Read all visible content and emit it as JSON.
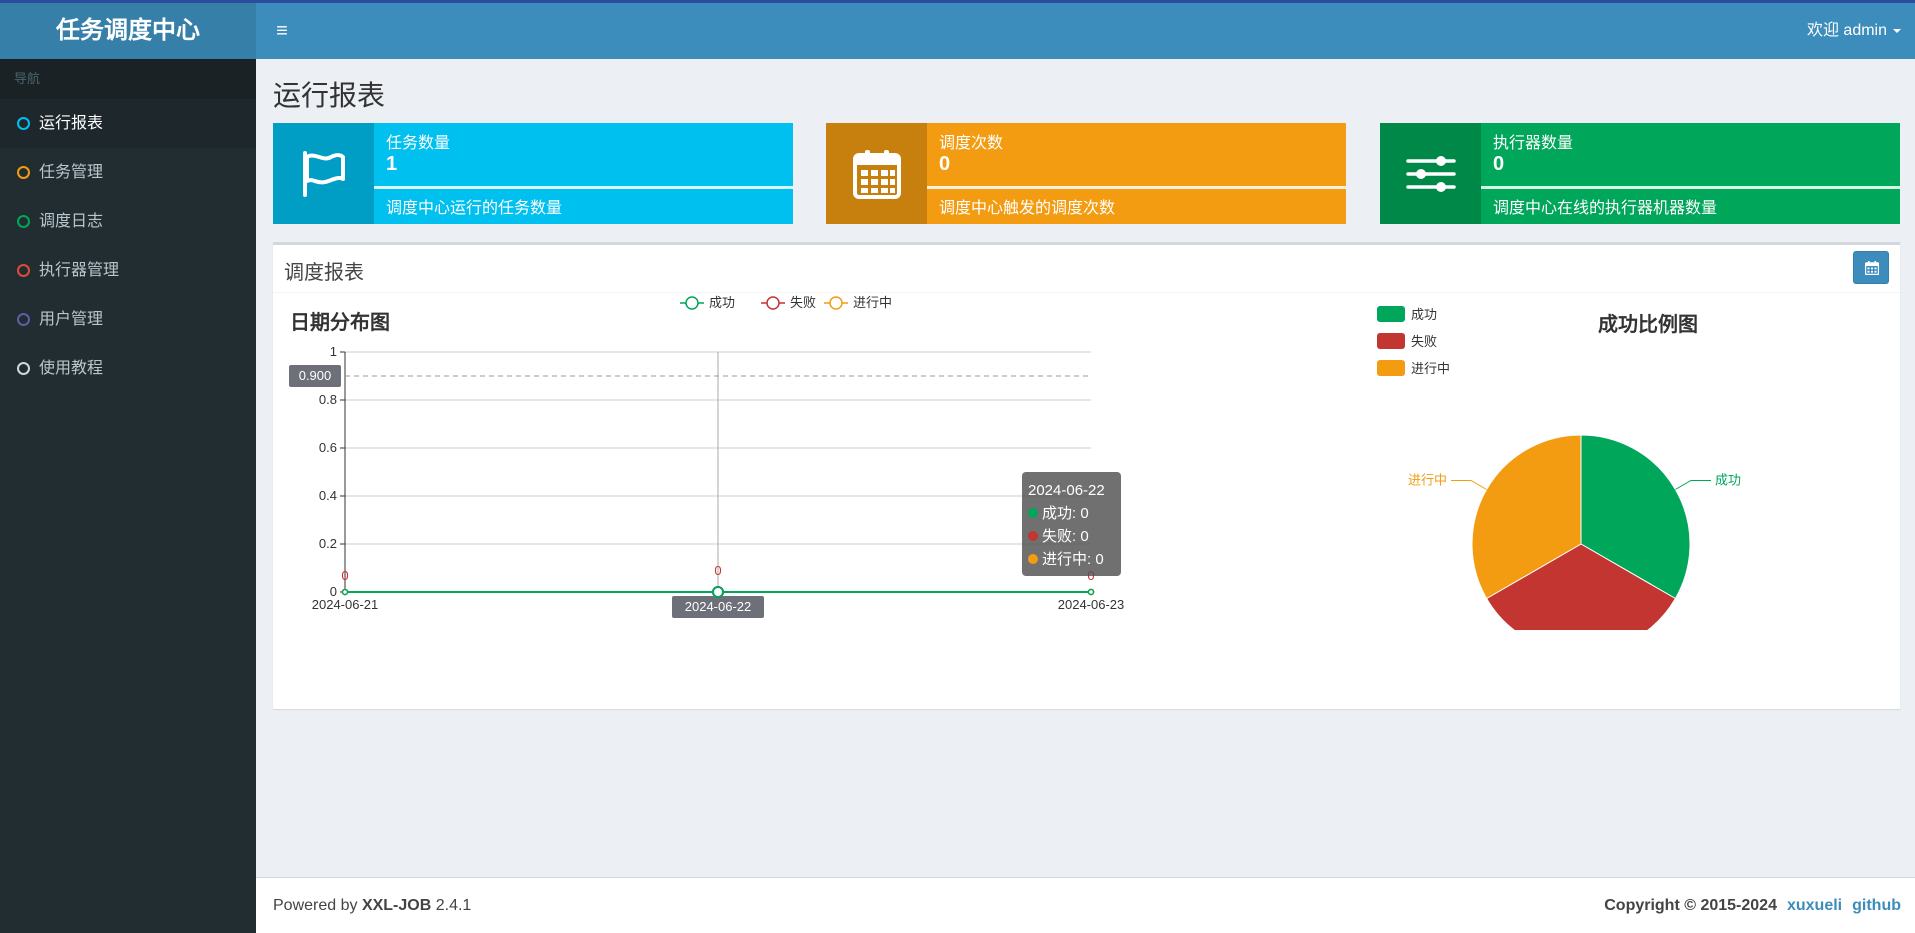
{
  "app": {
    "logo_title": "任务调度中心"
  },
  "header": {
    "user_greeting": "欢迎 admin"
  },
  "sidebar": {
    "section_label": "导航",
    "items": [
      {
        "label": "运行报表",
        "ring_color": "#00c0ef",
        "active": true
      },
      {
        "label": "任务管理",
        "ring_color": "#f39c12"
      },
      {
        "label": "调度日志",
        "ring_color": "#00a65a"
      },
      {
        "label": "执行器管理",
        "ring_color": "#dd4b39"
      },
      {
        "label": "用户管理",
        "ring_color": "#605ca8"
      },
      {
        "label": "使用教程",
        "ring_color": "#d2d6de"
      }
    ]
  },
  "page": {
    "title": "运行报表"
  },
  "info_boxes": [
    {
      "title": "任务数量",
      "number": "1",
      "desc": "调度中心运行的任务数量",
      "color": "#00c0ef",
      "icon": "flag-icon"
    },
    {
      "title": "调度次数",
      "number": "0",
      "desc": "调度中心触发的调度次数",
      "color": "#f39c12",
      "icon": "calendar-icon"
    },
    {
      "title": "执行器数量",
      "number": "0",
      "desc": "调度中心在线的执行器机器数量",
      "color": "#00a65a",
      "icon": "sliders-icon"
    }
  ],
  "report": {
    "title": "调度报表"
  },
  "colors": {
    "success": "#00a65a",
    "fail": "#c23531",
    "running": "#f39c12"
  },
  "chart_data": [
    {
      "type": "line",
      "title": "日期分布图",
      "x": [
        "2024-06-21",
        "2024-06-22",
        "2024-06-23"
      ],
      "series": [
        {
          "name": "成功",
          "values": [
            0,
            0,
            0
          ]
        },
        {
          "name": "失败",
          "values": [
            0,
            0,
            0
          ]
        },
        {
          "name": "进行中",
          "values": [
            0,
            0,
            0
          ]
        }
      ],
      "ylim": [
        0,
        1
      ],
      "yticks": [
        0,
        0.2,
        0.4,
        0.6,
        0.8,
        1
      ],
      "data_labels": [
        "0",
        "0",
        "0"
      ],
      "legend": "top-center",
      "grid": true,
      "crosshair": {
        "x": "2024-06-22",
        "x_label": "2024-06-22",
        "y": 0.9,
        "y_label": "0.900"
      },
      "tooltip": {
        "title": "2024-06-22",
        "lines": [
          "成功: 0",
          "失败: 0",
          "进行中: 0"
        ]
      }
    },
    {
      "type": "pie",
      "title": "成功比例图",
      "categories": [
        "成功",
        "失败",
        "进行中"
      ],
      "values": [
        1,
        1,
        1
      ],
      "legend": "top-left"
    }
  ],
  "footer": {
    "powered_prefix": "Powered by ",
    "product": "XXL-JOB",
    "version": " 2.4.1",
    "copyright": "Copyright © 2015-2024",
    "links": [
      "xuxueli",
      "github"
    ]
  }
}
